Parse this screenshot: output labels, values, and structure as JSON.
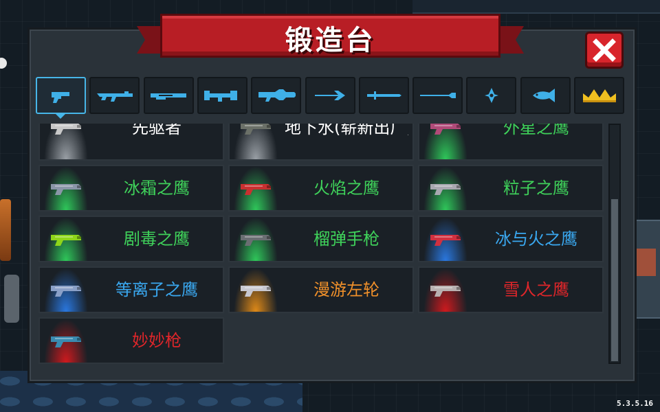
{
  "title": "锻造台",
  "version": "5.3.5.16",
  "colors": {
    "panel": "#2a3239",
    "banner": "#b81e25",
    "close": "#d8252c",
    "tab_active": "#47b6e8",
    "white": "#ffffff",
    "green": "#3fd25a",
    "blue": "#3aa8f0",
    "orange": "#f0902a",
    "red": "#e0262a"
  },
  "tabs": [
    {
      "icon": "pistol-icon",
      "active": true
    },
    {
      "icon": "rifle-icon",
      "active": false
    },
    {
      "icon": "shotgun-icon",
      "active": false
    },
    {
      "icon": "launcher-icon",
      "active": false
    },
    {
      "icon": "laser-rifle-icon",
      "active": false
    },
    {
      "icon": "bow-icon",
      "active": false
    },
    {
      "icon": "blade-icon",
      "active": false
    },
    {
      "icon": "spear-icon",
      "active": false
    },
    {
      "icon": "shuriken-icon",
      "active": false
    },
    {
      "icon": "fish-icon",
      "active": false
    },
    {
      "icon": "crown-icon",
      "active": false
    }
  ],
  "weapons": [
    {
      "name": "先驱者",
      "color": "#ffffff",
      "glow": "#9aa0a6",
      "gun": "#c8c8c8"
    },
    {
      "name": "地下水(崭新出厂)",
      "color": "#ffffff",
      "glow": "#9aa0a6",
      "gun": "#6b7068"
    },
    {
      "name": "外星之鹰",
      "color": "#3fd25a",
      "glow": "#2fc85a",
      "gun": "#b04a78"
    },
    {
      "name": "冰霜之鹰",
      "color": "#3fd25a",
      "glow": "#2fc85a",
      "gun": "#8a96a8"
    },
    {
      "name": "火焰之鹰",
      "color": "#3fd25a",
      "glow": "#2fc85a",
      "gun": "#c83030"
    },
    {
      "name": "粒子之鹰",
      "color": "#3fd25a",
      "glow": "#2fc85a",
      "gun": "#a8a8b0"
    },
    {
      "name": "剧毒之鹰",
      "color": "#3fd25a",
      "glow": "#2fc85a",
      "gun": "#8ed61a"
    },
    {
      "name": "榴弹手枪",
      "color": "#3fd25a",
      "glow": "#2fc85a",
      "gun": "#6a6e72"
    },
    {
      "name": "冰与火之鹰",
      "color": "#3aa8f0",
      "glow": "#2a78e0",
      "gun": "#d03040"
    },
    {
      "name": "等离子之鹰",
      "color": "#3aa8f0",
      "glow": "#2a78e0",
      "gun": "#8aa0c8"
    },
    {
      "name": "漫游左轮",
      "color": "#f0902a",
      "glow": "#e08a18",
      "gun": "#c8c8d0"
    },
    {
      "name": "雪人之鹰",
      "color": "#e0262a",
      "glow": "#d01a1e",
      "gun": "#b8b0b0"
    },
    {
      "name": "妙妙枪",
      "color": "#e0262a",
      "glow": "#d01a1e",
      "gun": "#3a8ab0"
    }
  ],
  "scroll": {
    "fraction": 0.67
  }
}
